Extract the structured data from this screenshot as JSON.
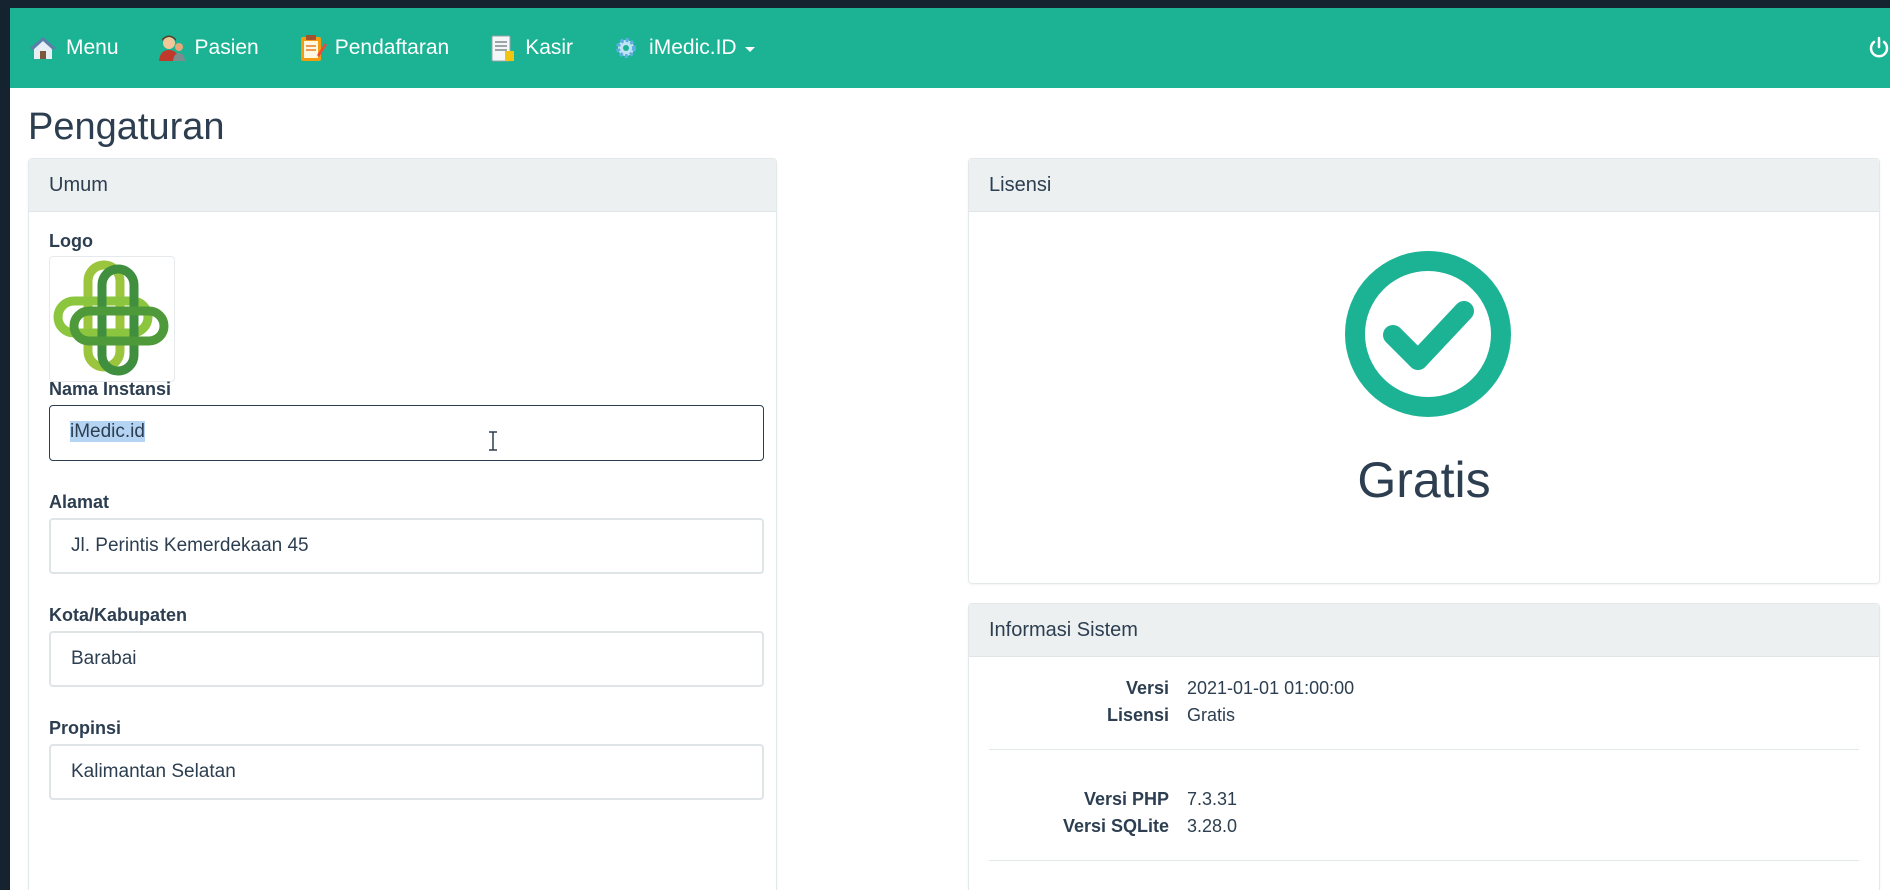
{
  "nav": {
    "items": [
      {
        "label": "Menu",
        "icon": "house-icon"
      },
      {
        "label": "Pasien",
        "icon": "patient-icon"
      },
      {
        "label": "Pendaftaran",
        "icon": "clipboard-icon"
      },
      {
        "label": "Kasir",
        "icon": "cashier-icon"
      },
      {
        "label": "iMedic.ID",
        "icon": "gear-icon"
      }
    ],
    "power_icon": "power-icon",
    "bg_color": "#1bb394"
  },
  "page": {
    "title": "Pengaturan"
  },
  "umum": {
    "heading": "Umum",
    "logo_label": "Logo",
    "nama_instansi": {
      "label": "Nama Instansi",
      "value": "iMedic.id"
    },
    "alamat": {
      "label": "Alamat",
      "value": "Jl. Perintis Kemerdekaan 45"
    },
    "kota": {
      "label": "Kota/Kabupaten",
      "value": "Barabai"
    },
    "propinsi": {
      "label": "Propinsi",
      "value": "Kalimantan Selatan"
    }
  },
  "lisensi": {
    "heading": "Lisensi",
    "status": "Gratis",
    "status_icon": "check-circle-icon",
    "accent": "#1bb394"
  },
  "informasi": {
    "heading": "Informasi Sistem",
    "rows": [
      {
        "key": "Versi",
        "value": "2021-01-01 01:00:00"
      },
      {
        "key": "Lisensi",
        "value": "Gratis"
      },
      {
        "key": "Versi PHP",
        "value": "7.3.31"
      },
      {
        "key": "Versi SQLite",
        "value": "3.28.0"
      }
    ]
  }
}
